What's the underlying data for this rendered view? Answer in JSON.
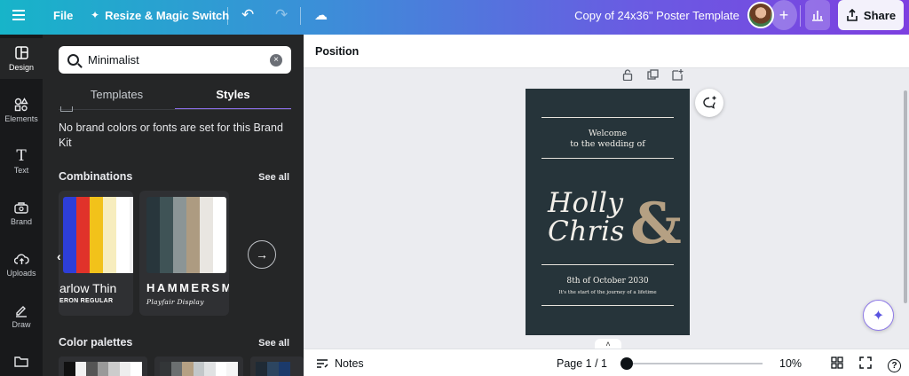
{
  "header": {
    "file_label": "File",
    "resize_label": "Resize & Magic Switch",
    "doc_title": "Copy of 24x36\" Poster Template",
    "share_label": "Share"
  },
  "rail": {
    "items": [
      {
        "label": "Design",
        "icon": "layout-icon"
      },
      {
        "label": "Elements",
        "icon": "shapes-icon"
      },
      {
        "label": "Text",
        "icon": "text-icon"
      },
      {
        "label": "Brand",
        "icon": "brand-icon"
      },
      {
        "label": "Uploads",
        "icon": "cloud-upload-icon"
      },
      {
        "label": "Draw",
        "icon": "pen-icon"
      }
    ]
  },
  "panel": {
    "search_value": "Minimalist",
    "tabs": [
      "Templates",
      "Styles"
    ],
    "active_tab": "Styles",
    "brand_message": "No brand colors or fonts are set for this Brand Kit",
    "combinations_title": "Combinations",
    "palettes_title": "Color palettes",
    "see_all": "See all",
    "combos": [
      {
        "font1": "arlow Thin",
        "font2": "ERON REGULAR",
        "colors": [
          "#2d3ed8",
          "#e0322a",
          "#f2c21a",
          "#f7edbe",
          "#ffffff",
          "#f2f2f2"
        ]
      },
      {
        "font1": "HAMMERSM",
        "font2": "Playfair Display",
        "colors": [
          "#28363c",
          "#3f5356",
          "#8b9596",
          "#ad9b81",
          "#e9e6e1",
          "#ffffff"
        ]
      }
    ],
    "palettes": [
      [
        "#111111",
        "#f2f2f2",
        "#555555",
        "#999999",
        "#cccccc",
        "#eeeeee",
        "#ffffff"
      ],
      [
        "#333638",
        "#6b6f70",
        "#b5a083",
        "#c2c7c9",
        "#e0e2e3",
        "#ffffff",
        "#f5f5f5"
      ],
      [
        "#1f2a35",
        "#2c4560",
        "#1b3a6b"
      ]
    ]
  },
  "toolbar": {
    "position_label": "Position"
  },
  "poster": {
    "welcome_line1": "Welcome",
    "welcome_line2": "to the wedding of",
    "name1": "Holly",
    "name2": "Chris",
    "amp": "&",
    "date": "8th of October 2030",
    "tagline": "It's the start of the journey of a lifetime",
    "bg_color": "#26343a",
    "accent_color": "#b5a083"
  },
  "footer": {
    "notes_label": "Notes",
    "page_indicator": "Page 1 / 1",
    "zoom_label": "10%",
    "help_label": "?"
  }
}
